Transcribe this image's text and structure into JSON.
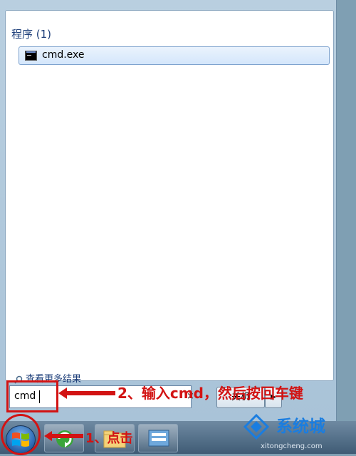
{
  "start_menu": {
    "programs_header": "程序 (1)",
    "program_item": "cmd.exe",
    "see_more": "查看更多结果",
    "search_value": "cmd",
    "clear_icon": "×",
    "shutdown_label": "关机",
    "shutdown_arrow": "▶"
  },
  "annotations": {
    "step2": "2、输入cmd，然后按回车键",
    "step1": "1、点击"
  },
  "watermark": {
    "brand": "系统城",
    "url": "xitongcheng.com"
  },
  "colors": {
    "annotation_red": "#d21313",
    "highlight_blue": "#7da2ce"
  }
}
